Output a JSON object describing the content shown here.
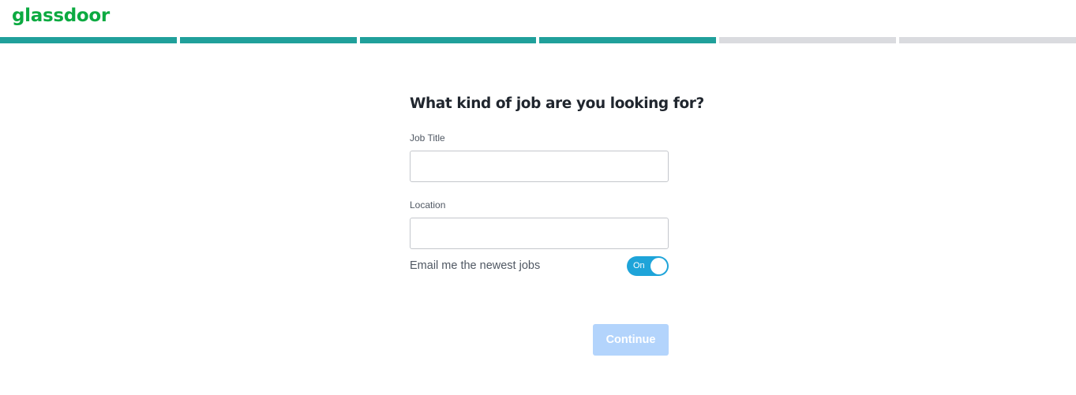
{
  "header": {
    "logo_text": "glassdoor",
    "brand_color": "#0caa41"
  },
  "progress": {
    "total_steps": 6,
    "completed_steps": 4,
    "complete_color": "#20a09b",
    "incomplete_color": "#dadbdf"
  },
  "form": {
    "heading": "What kind of job are you looking for?",
    "job_title": {
      "label": "Job Title",
      "value": "",
      "placeholder": ""
    },
    "location": {
      "label": "Location",
      "value": "",
      "placeholder": ""
    },
    "email_toggle": {
      "label": "Email me the newest jobs",
      "state_text": "On",
      "checked": true,
      "color": "#1ea4d9"
    },
    "continue_button": {
      "label": "Continue",
      "disabled": true,
      "color": "#b3d4fc"
    }
  }
}
